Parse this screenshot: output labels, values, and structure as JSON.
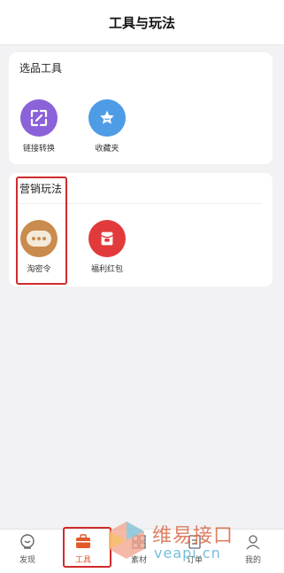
{
  "header": {
    "title": "工具与玩法"
  },
  "sections": [
    {
      "title": "选品工具",
      "tools": [
        {
          "label": "链接转换",
          "icon": "link-convert-icon",
          "color": "#8b62d9"
        },
        {
          "label": "收藏夹",
          "icon": "star-favorite-icon",
          "color": "#4e9be6"
        }
      ]
    },
    {
      "title": "营销玩法",
      "tools": [
        {
          "label": "淘密令",
          "icon": "chat-bubble-icon",
          "color": "#c98b4e"
        },
        {
          "label": "福利红包",
          "icon": "red-envelope-icon",
          "color": "#e23a3a"
        }
      ]
    }
  ],
  "tabbar": {
    "tabs": [
      {
        "label": "发现",
        "icon": "discover-icon"
      },
      {
        "label": "工具",
        "icon": "toolbox-icon",
        "active": true
      },
      {
        "label": "素材",
        "icon": "grid-icon"
      },
      {
        "label": "订单",
        "icon": "order-icon"
      },
      {
        "label": "我的",
        "icon": "profile-icon"
      }
    ]
  },
  "watermark": {
    "line1": "维易接口",
    "line2": "veapi.cn"
  },
  "colors": {
    "highlight": "#d12b2b",
    "active_tab": "#e25a2a"
  }
}
